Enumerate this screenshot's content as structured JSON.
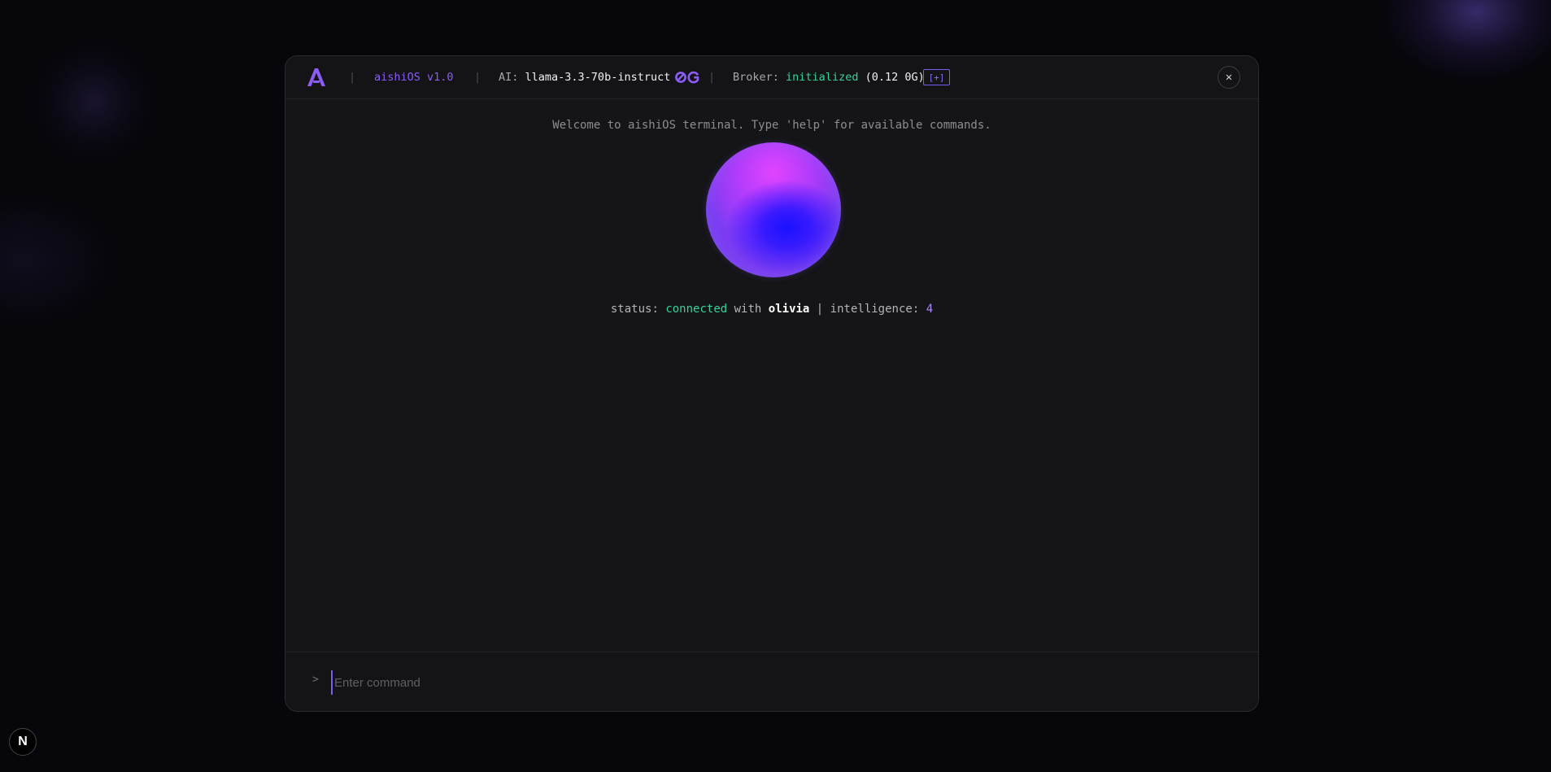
{
  "titlebar": {
    "app_name": "aishiOS v1.0",
    "separator": "|",
    "ai_label": "AI:",
    "model": "llama-3.3-70b-instruct",
    "broker_label": "Broker:",
    "broker_status": "initialized",
    "broker_balance": "(0.12 0G)",
    "broker_add_label": "[+]",
    "close_label": "✕"
  },
  "main": {
    "welcome": "Welcome to aishiOS terminal. Type 'help' for available commands.",
    "status_label": "status:",
    "status_value": "connected",
    "with_label": "with",
    "agent_name": "olivia",
    "divider": "|",
    "intelligence_label": "intelligence:",
    "intelligence_value": "4"
  },
  "input": {
    "prompt": ">",
    "placeholder": "Enter command",
    "value": ""
  },
  "dev_badge": {
    "label": "N"
  },
  "colors": {
    "accent": "#8b5cf6",
    "success": "#34d399",
    "background": "#07060b",
    "panel": "#151518"
  }
}
